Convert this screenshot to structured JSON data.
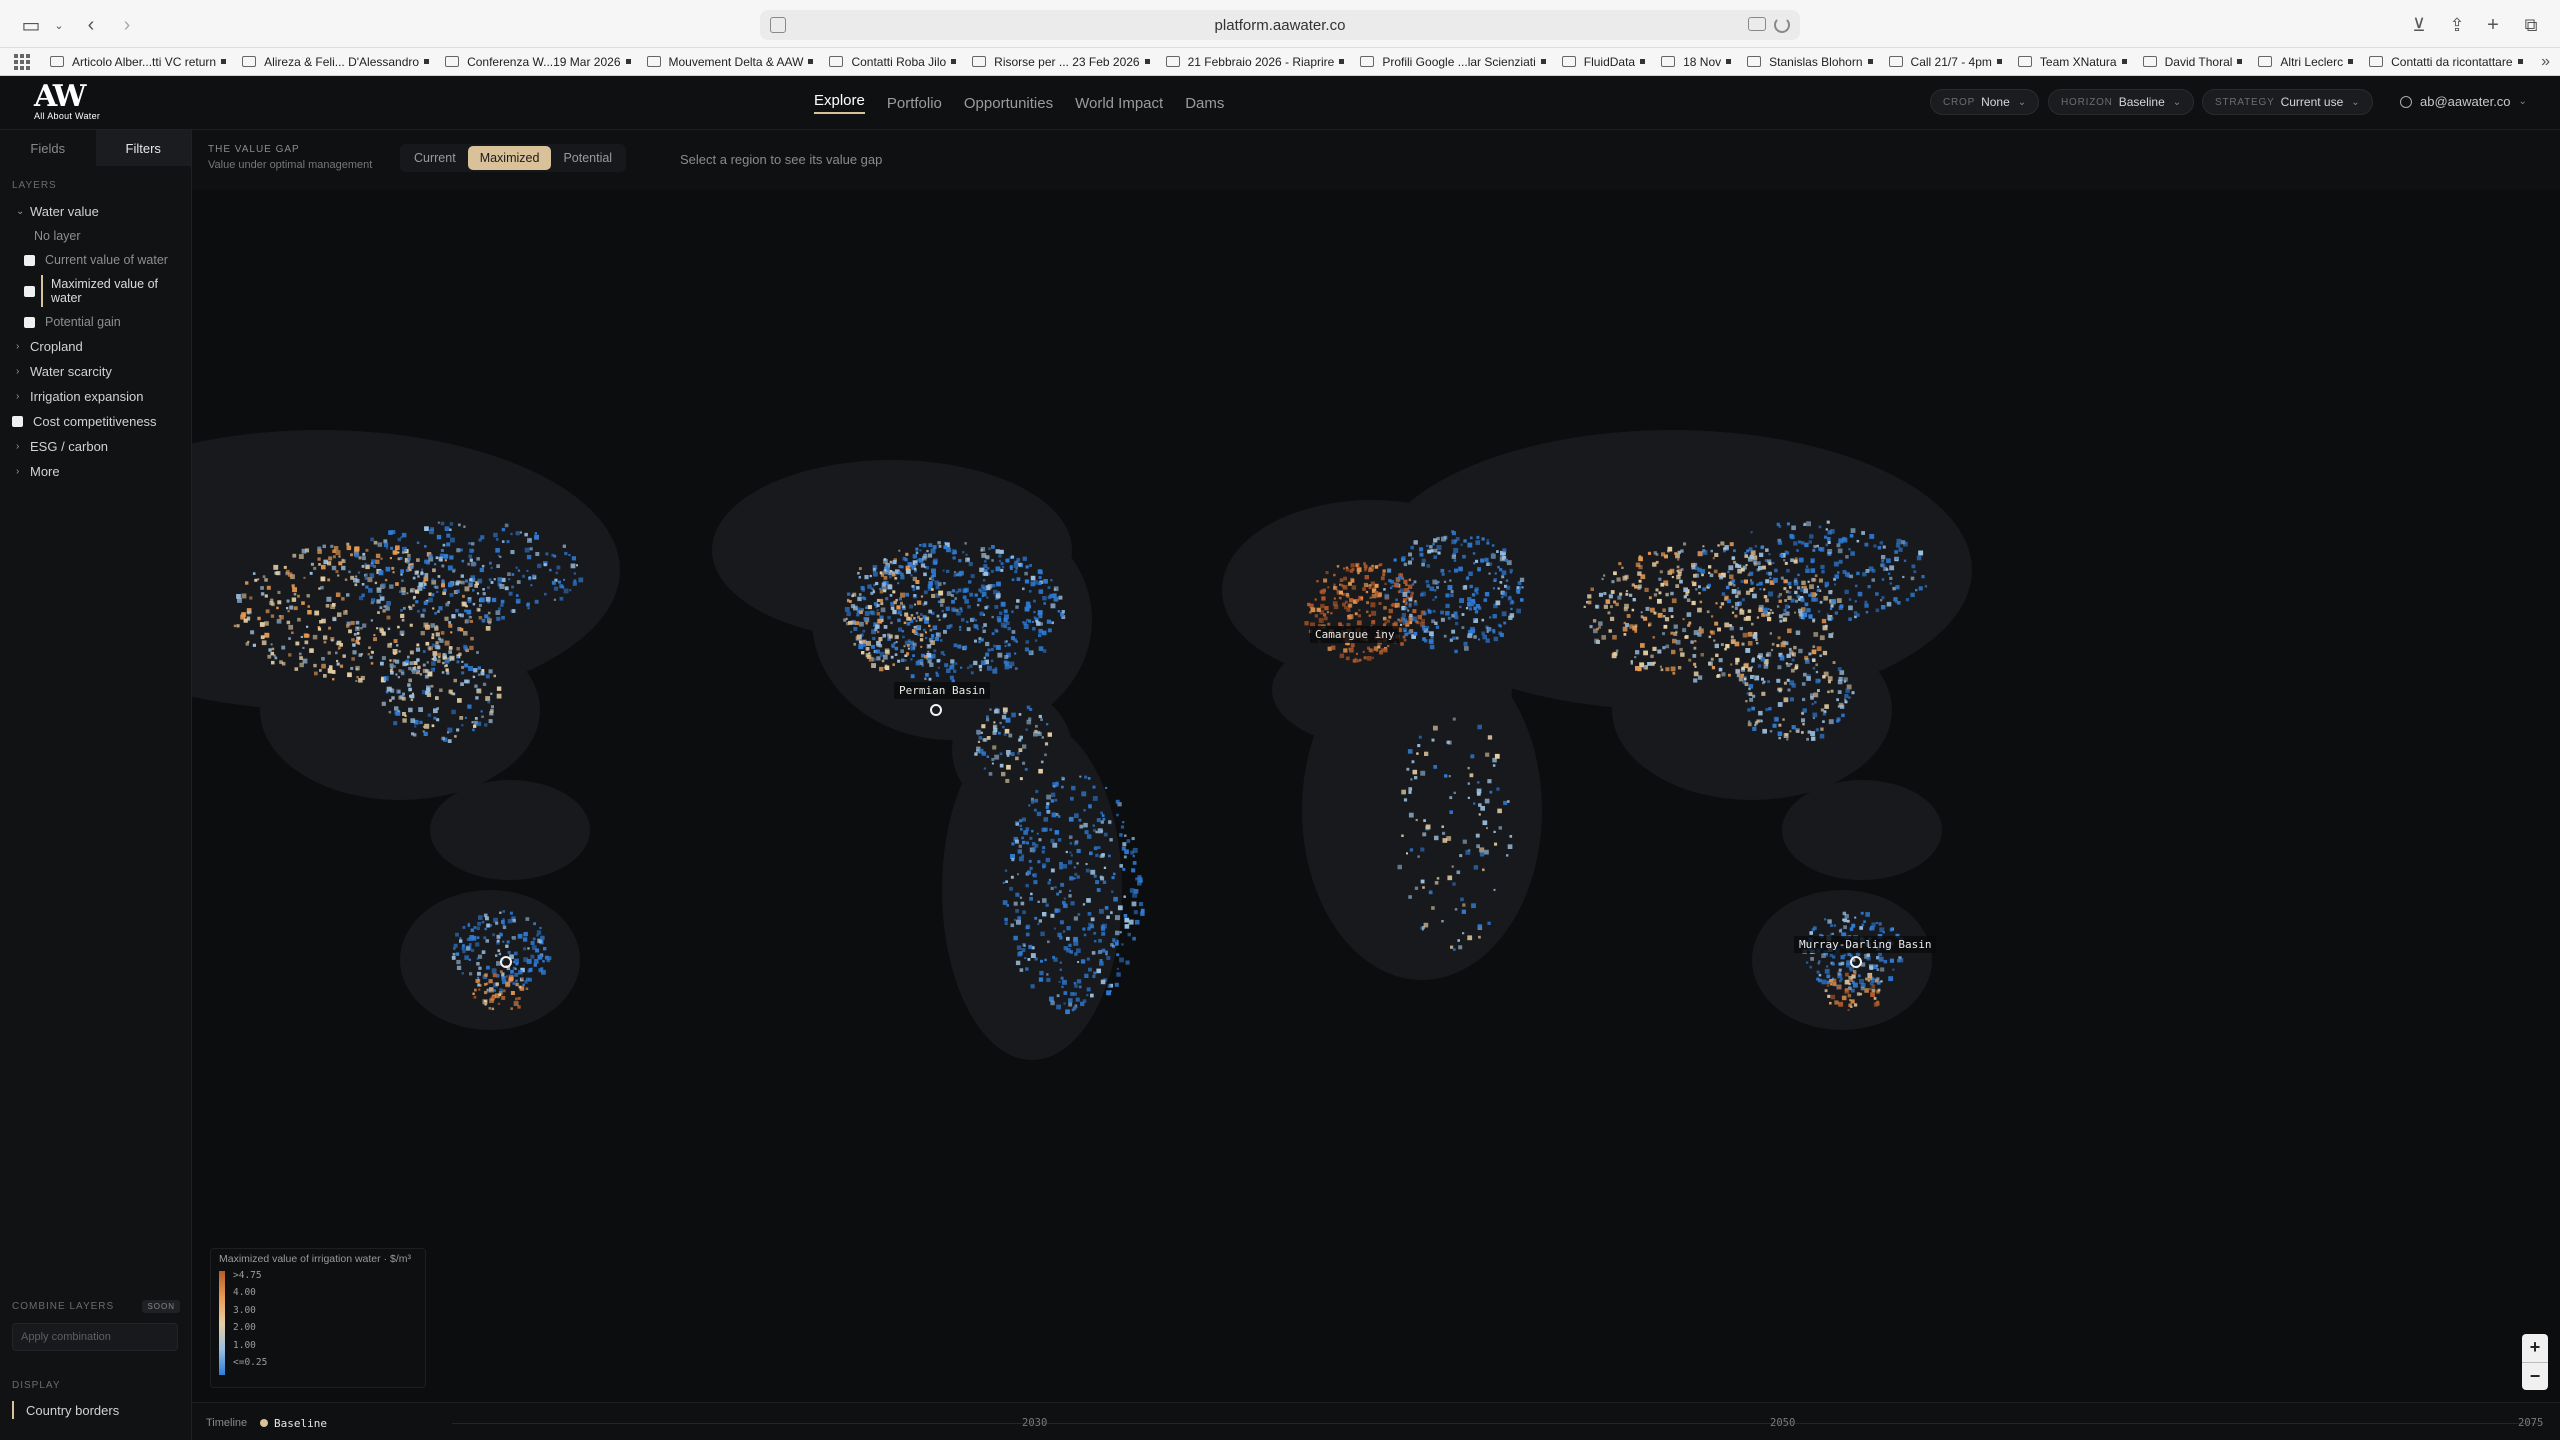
{
  "browser": {
    "url": "platform.aawater.co",
    "bookmarks": [
      {
        "label": "Articolo Alber...tti VC return",
        "type": "folder"
      },
      {
        "label": "Alireza & Feli... D'Alessandro",
        "type": "folder"
      },
      {
        "label": "Conferenza W...19 Mar 2026",
        "type": "folder"
      },
      {
        "label": "Mouvement Delta & AAW",
        "type": "folder"
      },
      {
        "label": "Contatti Roba Jilo",
        "type": "folder"
      },
      {
        "label": "Risorse per ... 23 Feb 2026",
        "type": "folder"
      },
      {
        "label": "21 Febbraio 2026 - Riaprire",
        "type": "folder"
      },
      {
        "label": "Profili Google ...lar Scienziati",
        "type": "folder"
      },
      {
        "label": "FluidData",
        "type": "folder"
      },
      {
        "label": "18 Nov",
        "type": "folder"
      },
      {
        "label": "Stanislas Blohorn",
        "type": "folder"
      },
      {
        "label": "Call 21/7 - 4pm",
        "type": "folder"
      },
      {
        "label": "Team XNatura",
        "type": "folder"
      },
      {
        "label": "David Thoral",
        "type": "folder"
      },
      {
        "label": "Altri Leclerc",
        "type": "folder"
      },
      {
        "label": "Contatti da ricontattare",
        "type": "folder"
      }
    ]
  },
  "header": {
    "logo_mark": "AW",
    "logo_sub": "All About Water",
    "nav": [
      "Explore",
      "Portfolio",
      "Opportunities",
      "World Impact",
      "Dams"
    ],
    "active_nav": "Explore",
    "crop": {
      "key": "CROP",
      "value": "None"
    },
    "horizon": {
      "key": "HORIZON",
      "value": "Baseline"
    },
    "strategy": {
      "key": "STRATEGY",
      "value": "Current use"
    },
    "user": "ab@aawater.co"
  },
  "sidebar": {
    "tabs": [
      "Fields",
      "Filters"
    ],
    "active_tab": "Filters",
    "layers_label": "LAYERS",
    "water_value": {
      "label": "Water value",
      "no_layer": "No layer",
      "current": "Current value of water",
      "maximized": "Maximized value of water",
      "potential": "Potential gain"
    },
    "groups": [
      "Cropland",
      "Water scarcity",
      "Irrigation expansion",
      "Cost competitiveness",
      "ESG / carbon",
      "More"
    ],
    "combine_label": "COMBINE LAYERS",
    "combine_badge": "SOON",
    "combine_placeholder": "Apply combination",
    "display_label": "DISPLAY",
    "display_item": "Country borders"
  },
  "toolbar": {
    "title": "THE VALUE GAP",
    "subtitle": "Value under optimal management",
    "modes": [
      "Current",
      "Maximized",
      "Potential"
    ],
    "active_mode": "Maximized",
    "hint": "Select a region to see its value gap"
  },
  "map": {
    "labels": [
      "Permian Basin",
      "Camargue iny",
      "Murray-Darling Basin"
    ],
    "legend_title": "Maximized value of irrigation water · $/m³",
    "legend_ticks": [
      ">4.75",
      "4.00",
      "3.00",
      "2.00",
      "1.00",
      "<=0.25"
    ],
    "legend_colors": [
      "#b75b2a",
      "#e89b54",
      "#e6cfa4",
      "#9cc1e0",
      "#2f7cd6"
    ],
    "zoom_in": "+",
    "zoom_out": "−"
  },
  "timeline": {
    "label": "Timeline",
    "current": "Baseline",
    "years": [
      "2030",
      "2050",
      "2075"
    ]
  }
}
